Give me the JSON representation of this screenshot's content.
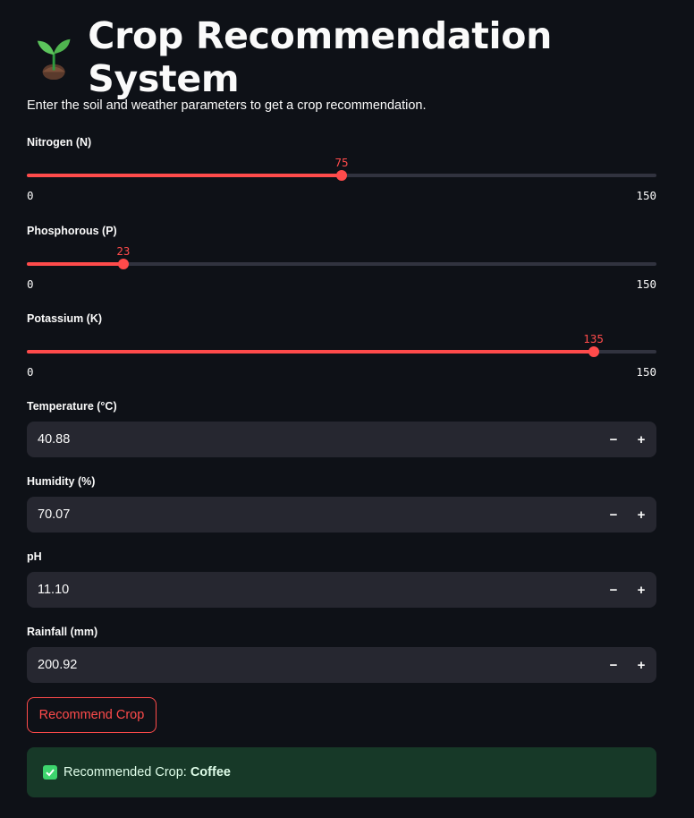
{
  "header": {
    "title": "Crop Recommendation System",
    "icon": "seedling-icon",
    "subtitle": "Enter the soil and weather parameters to get a crop recommendation."
  },
  "sliders": [
    {
      "label": "Nitrogen (N)",
      "value": 75,
      "min": 0,
      "max": 150
    },
    {
      "label": "Phosphorous (P)",
      "value": 23,
      "min": 0,
      "max": 150
    },
    {
      "label": "Potassium (K)",
      "value": 135,
      "min": 0,
      "max": 150
    }
  ],
  "inputs": [
    {
      "label": "Temperature (°C)",
      "value": "40.88"
    },
    {
      "label": "Humidity (%)",
      "value": "70.07"
    },
    {
      "label": "pH",
      "value": "11.10"
    },
    {
      "label": "Rainfall (mm)",
      "value": "200.92"
    }
  ],
  "stepper": {
    "minus": "−",
    "plus": "+"
  },
  "actions": {
    "recommend_label": "Recommend Crop"
  },
  "result": {
    "prefix": "Recommended Crop:",
    "crop": "Coffee",
    "icon": "check-icon"
  },
  "colors": {
    "background": "#0e1117",
    "accent": "#ff4b4b",
    "input_bg": "#262730",
    "success_bg": "#173928",
    "success_icon": "#3dd56d"
  }
}
